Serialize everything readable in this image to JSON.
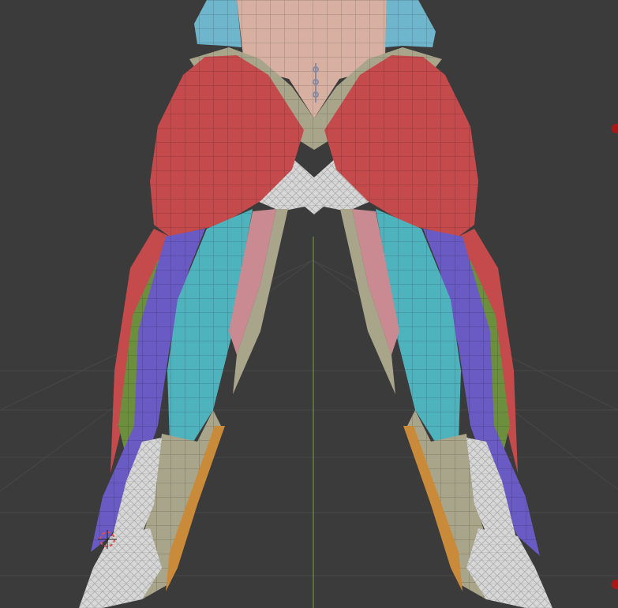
{
  "viewport": {
    "background": "#3b3b3b",
    "grid_color": "#474747",
    "axis_y_color": "#6f8f3a"
  },
  "model": {
    "colors": {
      "torso_skin": "#d8b0a2",
      "gluteus": "#c44a4c",
      "tendon": "#a9a58a",
      "hamstring_cyan": "#4fb3bd",
      "hamstring_purple": "#6a5ac4",
      "gracilis_green": "#6c8f3e",
      "adductor_pink": "#c98a92",
      "bone": "#d7d7d7",
      "lat_blue": "#6fb6cc",
      "orange_muscle": "#c98a3a"
    }
  },
  "gizmos": {
    "cursor_color": "#e05050",
    "light_marker_color": "#b01515"
  }
}
